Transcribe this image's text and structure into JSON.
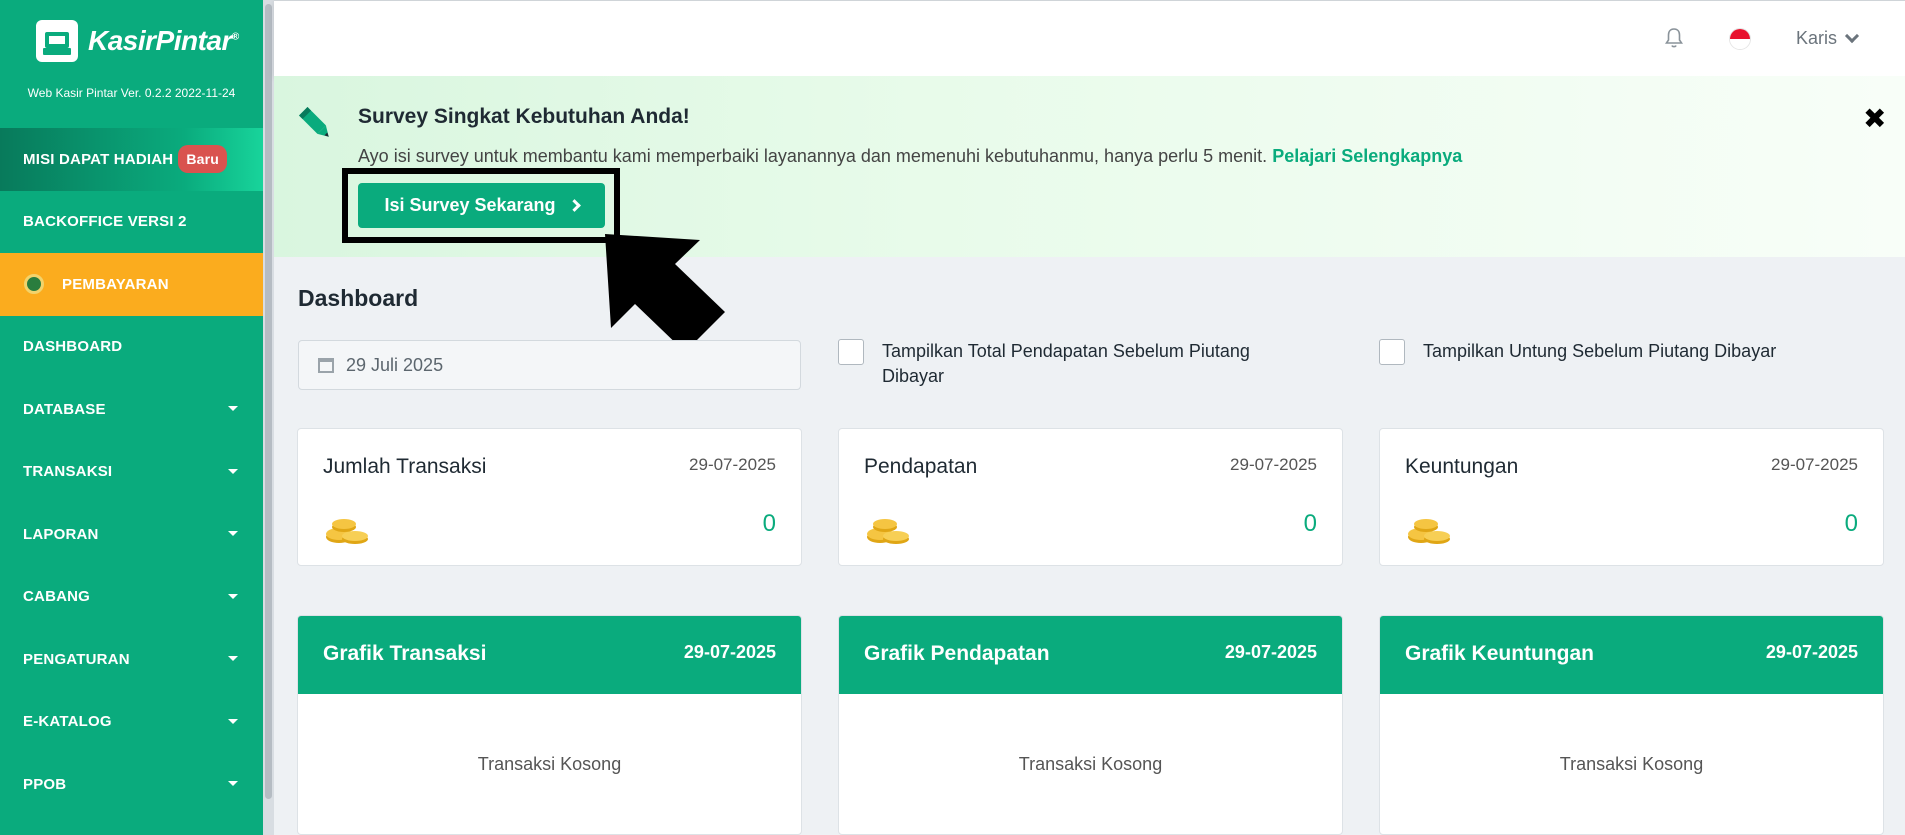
{
  "brand": {
    "name": "KasirPintar",
    "reg_mark": "®",
    "version": "Web Kasir Pintar Ver. 0.2.2 2022-11-24"
  },
  "sidebar": {
    "items": [
      {
        "label": "MISI DAPAT HADIAH",
        "badge": "Baru"
      },
      {
        "label": "BACKOFFICE VERSI 2"
      },
      {
        "label": "PEMBAYARAN"
      },
      {
        "label": "DASHBOARD"
      },
      {
        "label": "DATABASE"
      },
      {
        "label": "TRANSAKSI"
      },
      {
        "label": "LAPORAN"
      },
      {
        "label": "CABANG"
      },
      {
        "label": "PENGATURAN"
      },
      {
        "label": "E-KATALOG"
      },
      {
        "label": "PPOB"
      }
    ]
  },
  "topbar": {
    "user": "Karis"
  },
  "survey": {
    "title": "Survey Singkat Kebutuhan Anda!",
    "description": "Ayo isi survey untuk membantu kami memperbaiki layanannya dan memenuhi kebutuhanmu, hanya perlu 5 menit.",
    "link": "Pelajari Selengkapnya",
    "button": "Isi Survey Sekarang",
    "close": "✖"
  },
  "dashboard": {
    "title": "Dashboard",
    "date": "29 Juli 2025",
    "checkbox1": "Tampilkan Total Pendapatan Sebelum Piutang Dibayar",
    "checkbox2": "Tampilkan Untung Sebelum Piutang Dibayar",
    "cards": [
      {
        "title": "Jumlah Transaksi",
        "date": "29-07-2025",
        "value": "0"
      },
      {
        "title": "Pendapatan",
        "date": "29-07-2025",
        "value": "0"
      },
      {
        "title": "Keuntungan",
        "date": "29-07-2025",
        "value": "0"
      }
    ],
    "graphs": [
      {
        "title": "Grafik Transaksi",
        "date": "29-07-2025",
        "empty": "Transaksi Kosong"
      },
      {
        "title": "Grafik Pendapatan",
        "date": "29-07-2025",
        "empty": "Transaksi Kosong"
      },
      {
        "title": "Grafik Keuntungan",
        "date": "29-07-2025",
        "empty": "Transaksi Kosong"
      }
    ]
  },
  "colors": {
    "primary": "#0aab7d",
    "accent": "#fbac1e",
    "badge": "#d9534f"
  }
}
